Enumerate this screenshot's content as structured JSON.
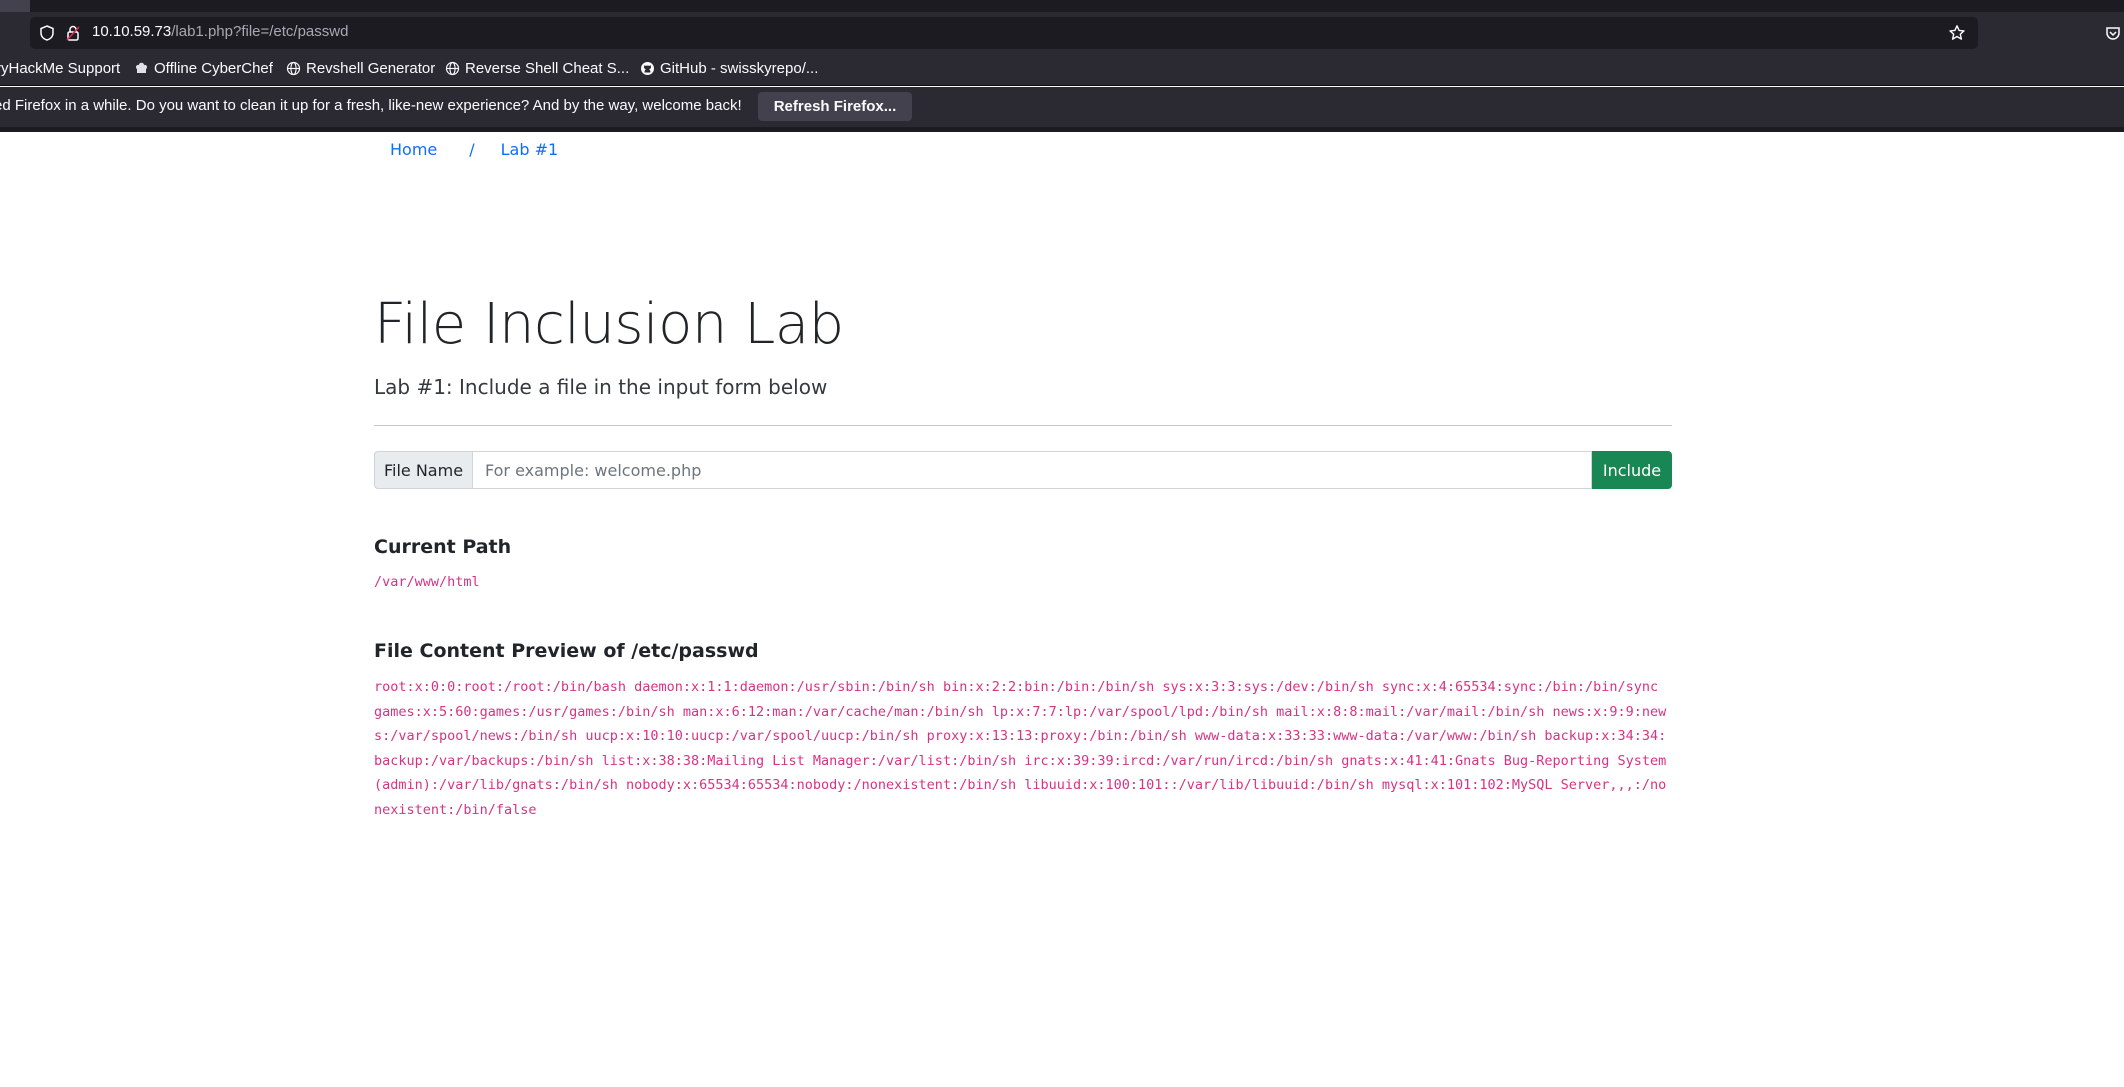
{
  "browser": {
    "url_host": "10.10.59.73",
    "url_path": "/lab1.php?file=/etc/passwd",
    "bookmarks": [
      {
        "label": "ryHackMe Support",
        "icon": "none"
      },
      {
        "label": "Offline CyberChef",
        "icon": "chef-icon"
      },
      {
        "label": "Revshell Generator",
        "icon": "globe-icon"
      },
      {
        "label": "Reverse Shell Cheat S...",
        "icon": "globe-icon"
      },
      {
        "label": "GitHub - swisskyrepo/...",
        "icon": "github-icon"
      }
    ],
    "notification": {
      "text": "ed Firefox in a while. Do you want to clean it up for a fresh, like-new experience? And by the way, welcome back!",
      "button_label": "Refresh Firefox..."
    }
  },
  "page": {
    "breadcrumb": {
      "home": "Home",
      "separator": "/",
      "current": "Lab #1"
    },
    "title": "File Inclusion Lab",
    "subtitle": "Lab #1: Include a file in the input form below",
    "form": {
      "label": "File Name",
      "placeholder": "For example: welcome.php",
      "value": "",
      "button_label": "Include"
    },
    "current_path": {
      "heading": "Current Path",
      "value": "/var/www/html"
    },
    "file_preview": {
      "heading_prefix": "File Content Preview of ",
      "heading_file": "/etc/passwd",
      "content": "root:x:0:0:root:/root:/bin/bash daemon:x:1:1:daemon:/usr/sbin:/bin/sh bin:x:2:2:bin:/bin:/bin/sh sys:x:3:3:sys:/dev:/bin/sh sync:x:4:65534:sync:/bin:/bin/sync games:x:5:60:games:/usr/games:/bin/sh man:x:6:12:man:/var/cache/man:/bin/sh lp:x:7:7:lp:/var/spool/lpd:/bin/sh mail:x:8:8:mail:/var/mail:/bin/sh news:x:9:9:news:/var/spool/news:/bin/sh uucp:x:10:10:uucp:/var/spool/uucp:/bin/sh proxy:x:13:13:proxy:/bin:/bin/sh www-data:x:33:33:www-data:/var/www:/bin/sh backup:x:34:34:backup:/var/backups:/bin/sh list:x:38:38:Mailing List Manager:/var/list:/bin/sh irc:x:39:39:ircd:/var/run/ircd:/bin/sh gnats:x:41:41:Gnats Bug-Reporting System (admin):/var/lib/gnats:/bin/sh nobody:x:65534:65534:nobody:/nonexistent:/bin/sh libuuid:x:100:101::/var/lib/libuuid:/bin/sh mysql:x:101:102:MySQL Server,,,:/nonexistent:/bin/false"
    }
  }
}
